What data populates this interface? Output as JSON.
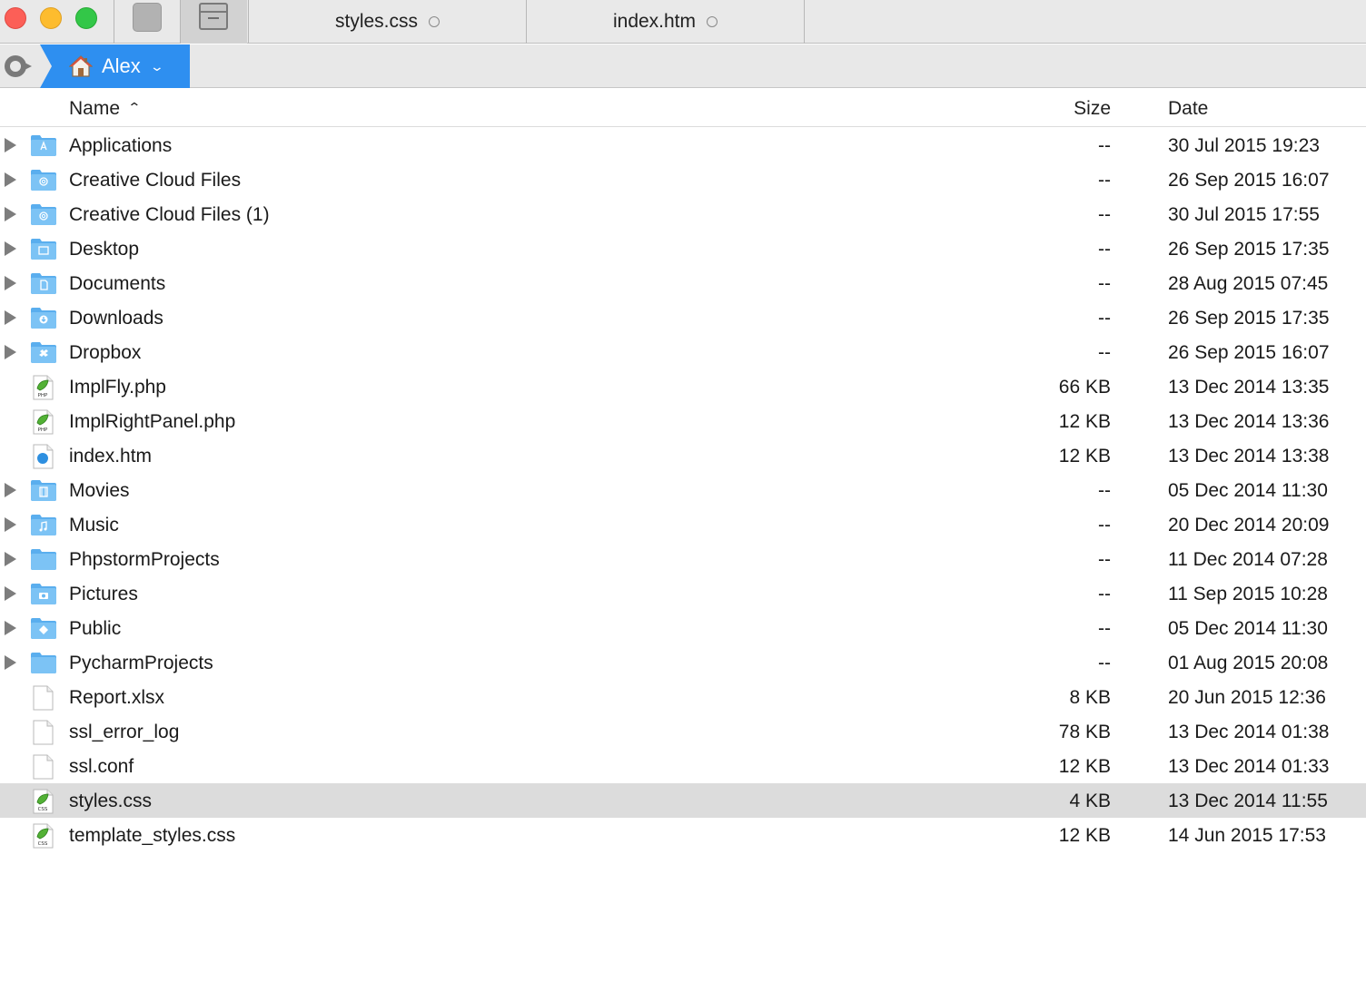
{
  "tabs": [
    {
      "label": "styles.css"
    },
    {
      "label": "index.htm"
    }
  ],
  "path": {
    "folder": "Alex"
  },
  "columns": {
    "name": "Name",
    "size": "Size",
    "date": "Date"
  },
  "rows": [
    {
      "name": "Applications",
      "size": "--",
      "date": "30 Jul 2015 19:23",
      "kind": "folder",
      "icon": "applications-folder-icon",
      "glyph": "A"
    },
    {
      "name": "Creative Cloud Files",
      "size": "--",
      "date": "26 Sep 2015 16:07",
      "kind": "folder",
      "icon": "creative-cloud-folder-icon",
      "glyph": "cc"
    },
    {
      "name": "Creative Cloud Files (1)",
      "size": "--",
      "date": "30 Jul 2015 17:55",
      "kind": "folder",
      "icon": "creative-cloud-folder-icon",
      "glyph": "cc"
    },
    {
      "name": "Desktop",
      "size": "--",
      "date": "26 Sep 2015 17:35",
      "kind": "folder",
      "icon": "desktop-folder-icon",
      "glyph": "box"
    },
    {
      "name": "Documents",
      "size": "--",
      "date": "28 Aug 2015 07:45",
      "kind": "folder",
      "icon": "documents-folder-icon",
      "glyph": "doc"
    },
    {
      "name": "Downloads",
      "size": "--",
      "date": "26 Sep 2015 17:35",
      "kind": "folder",
      "icon": "downloads-folder-icon",
      "glyph": "down"
    },
    {
      "name": "Dropbox",
      "size": "--",
      "date": "26 Sep 2015 16:07",
      "kind": "folder",
      "icon": "dropbox-folder-icon",
      "glyph": "drop"
    },
    {
      "name": "ImplFly.php",
      "size": "66 KB",
      "date": "13 Dec 2014 13:35",
      "kind": "file",
      "icon": "php-file-icon",
      "glyph": "PHP"
    },
    {
      "name": "ImplRightPanel.php",
      "size": "12 KB",
      "date": "13 Dec 2014 13:36",
      "kind": "file",
      "icon": "php-file-icon",
      "glyph": "PHP"
    },
    {
      "name": "index.htm",
      "size": "12 KB",
      "date": "13 Dec 2014 13:38",
      "kind": "file",
      "icon": "html-file-icon",
      "glyph": "safari"
    },
    {
      "name": "Movies",
      "size": "--",
      "date": "05 Dec 2014 11:30",
      "kind": "folder",
      "icon": "movies-folder-icon",
      "glyph": "film"
    },
    {
      "name": "Music",
      "size": "--",
      "date": "20 Dec 2014 20:09",
      "kind": "folder",
      "icon": "music-folder-icon",
      "glyph": "note"
    },
    {
      "name": "PhpstormProjects",
      "size": "--",
      "date": "11 Dec 2014 07:28",
      "kind": "folder",
      "icon": "folder-icon",
      "glyph": ""
    },
    {
      "name": "Pictures",
      "size": "--",
      "date": "11 Sep 2015 10:28",
      "kind": "folder",
      "icon": "pictures-folder-icon",
      "glyph": "cam"
    },
    {
      "name": "Public",
      "size": "--",
      "date": "05 Dec 2014 11:30",
      "kind": "folder",
      "icon": "public-folder-icon",
      "glyph": "diamond"
    },
    {
      "name": "PycharmProjects",
      "size": "--",
      "date": "01 Aug 2015 20:08",
      "kind": "folder",
      "icon": "folder-icon",
      "glyph": ""
    },
    {
      "name": "Report.xlsx",
      "size": "8 KB",
      "date": "20 Jun 2015 12:36",
      "kind": "file",
      "icon": "blank-file-icon",
      "glyph": ""
    },
    {
      "name": "ssl_error_log",
      "size": "78 KB",
      "date": "13 Dec 2014 01:38",
      "kind": "file",
      "icon": "blank-file-icon",
      "glyph": ""
    },
    {
      "name": "ssl.conf",
      "size": "12 KB",
      "date": "13 Dec 2014 01:33",
      "kind": "file",
      "icon": "blank-file-icon",
      "glyph": ""
    },
    {
      "name": "styles.css",
      "size": "4 KB",
      "date": "13 Dec 2014 11:55",
      "kind": "file",
      "icon": "css-file-icon",
      "glyph": "CSS",
      "selected": true
    },
    {
      "name": "template_styles.css",
      "size": "12 KB",
      "date": "14 Jun 2015 17:53",
      "kind": "file",
      "icon": "css-file-icon",
      "glyph": "CSS"
    }
  ],
  "colors": {
    "accent": "#2e8ff0",
    "folder": "#6ab8f2",
    "selected_row": "#dcdcdc"
  }
}
